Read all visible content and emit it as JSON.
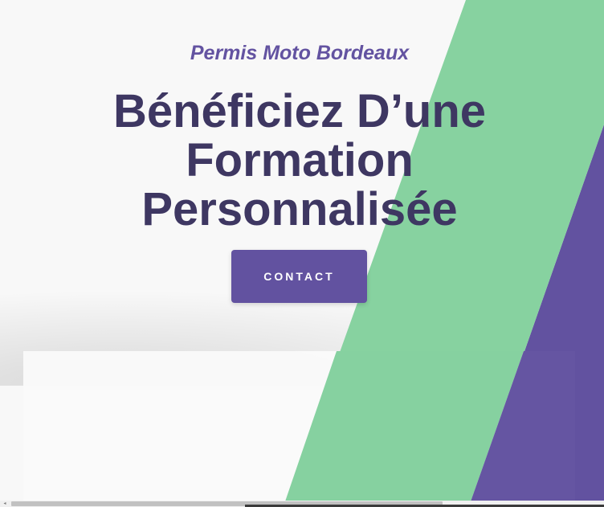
{
  "hero": {
    "subtitle": "Permis Moto Bordeaux",
    "title": "Bénéficiez D’une Formation Personnalisée",
    "contact_label": "CONTACT"
  },
  "colors": {
    "background": "#f8f8f8",
    "accent_purple": "#6252a0",
    "accent_green": "#87d2a0",
    "title_dark": "#3e3762"
  },
  "scrollbar": {
    "left_arrow_icon": "◂"
  }
}
